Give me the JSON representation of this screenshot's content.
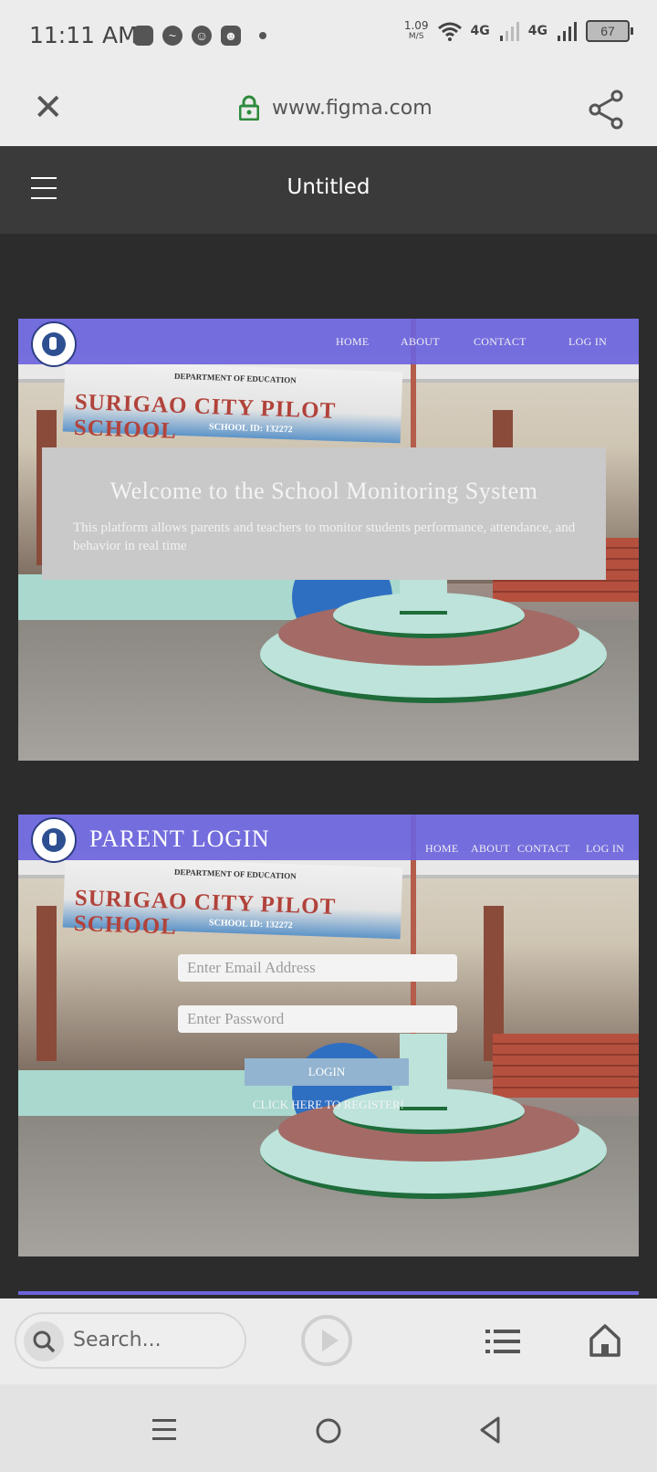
{
  "status_bar": {
    "time": "11:11 AM",
    "net_speed_value": "1.09",
    "net_speed_unit": "M/S",
    "network1": "4G",
    "network2": "4G",
    "battery": "67"
  },
  "browser": {
    "url": "www.figma.com"
  },
  "figma_header": {
    "title": "Untitled"
  },
  "frame_home": {
    "sign_line1": "DEPARTMENT OF EDUCATION",
    "sign_main": "SURIGAO CITY PILOT SCHOOL",
    "sign_id": "SCHOOL ID: 132272",
    "nav": [
      "HOME",
      "ABOUT",
      "CONTACT",
      "LOG IN"
    ],
    "welcome_title": "Welcome to the School Monitoring System",
    "welcome_text": "This platform allows parents and teachers to monitor students performance, attendance, and behavior in real time"
  },
  "frame_login": {
    "page_title": "PARENT LOGIN",
    "nav": [
      "HOME",
      "ABOUT",
      "CONTACT",
      "LOG IN"
    ],
    "email_placeholder": "Enter Email Address",
    "password_placeholder": "Enter Password",
    "login_button": "LOGIN",
    "register_link": "CLICK HERE TO REGISTER!"
  },
  "bottom_bar": {
    "search_placeholder": "Search..."
  },
  "colors": {
    "nav_header": "#6c64dc",
    "figma_bar": "#3a3a3a",
    "canvas": "#2c2c2c",
    "login_button": "#93b4d0"
  }
}
